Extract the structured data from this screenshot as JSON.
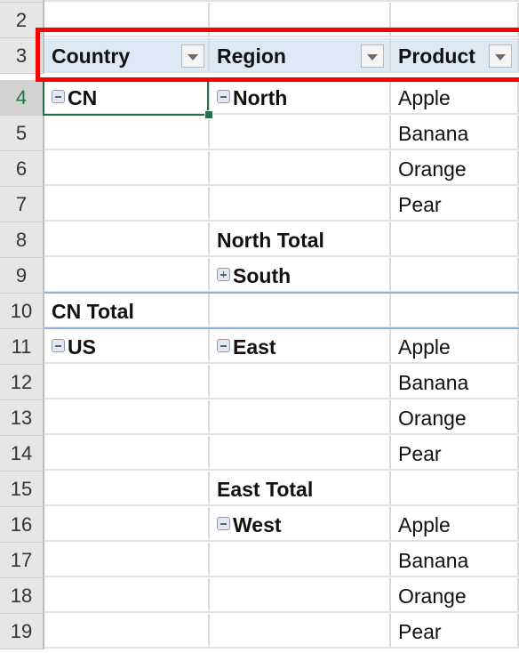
{
  "sheet": {
    "selected_row": "4",
    "selected_cell": "A4",
    "highlight_color": "#ff0000",
    "header_fill": "#dde9f5",
    "header_row": {
      "row_number": "3",
      "columns": [
        {
          "label": "Country",
          "filter": "filter-dropdown-icon"
        },
        {
          "label": "Region",
          "filter": "filter-dropdown-icon"
        },
        {
          "label": "Product",
          "filter": "filter-dropdown-icon"
        }
      ]
    },
    "rows": [
      {
        "n": "2",
        "a": "",
        "b": "",
        "c": ""
      },
      {
        "n": "4",
        "a": "CN",
        "a_icon": "collapse",
        "b": "North",
        "b_icon": "collapse",
        "c": "Apple"
      },
      {
        "n": "5",
        "a": "",
        "b": "",
        "c": "Banana"
      },
      {
        "n": "6",
        "a": "",
        "b": "",
        "c": "Orange"
      },
      {
        "n": "7",
        "a": "",
        "b": "",
        "c": "Pear"
      },
      {
        "n": "8",
        "a": "",
        "b": "North Total",
        "c": ""
      },
      {
        "n": "9",
        "a": "",
        "b": "South",
        "b_icon": "expand",
        "c": ""
      },
      {
        "n": "10",
        "a": "CN Total",
        "b": "",
        "c": ""
      },
      {
        "n": "11",
        "a": "US",
        "a_icon": "collapse",
        "b": "East",
        "b_icon": "collapse",
        "c": "Apple"
      },
      {
        "n": "12",
        "a": "",
        "b": "",
        "c": "Banana"
      },
      {
        "n": "13",
        "a": "",
        "b": "",
        "c": "Orange"
      },
      {
        "n": "14",
        "a": "",
        "b": "",
        "c": "Pear"
      },
      {
        "n": "15",
        "a": "",
        "b": "East Total",
        "c": ""
      },
      {
        "n": "16",
        "a": "",
        "b": "West",
        "b_icon": "collapse",
        "c": "Apple"
      },
      {
        "n": "17",
        "a": "",
        "b": "",
        "c": "Banana"
      },
      {
        "n": "18",
        "a": "",
        "b": "",
        "c": "Orange"
      },
      {
        "n": "19",
        "a": "",
        "b": "",
        "c": "Pear"
      }
    ]
  }
}
